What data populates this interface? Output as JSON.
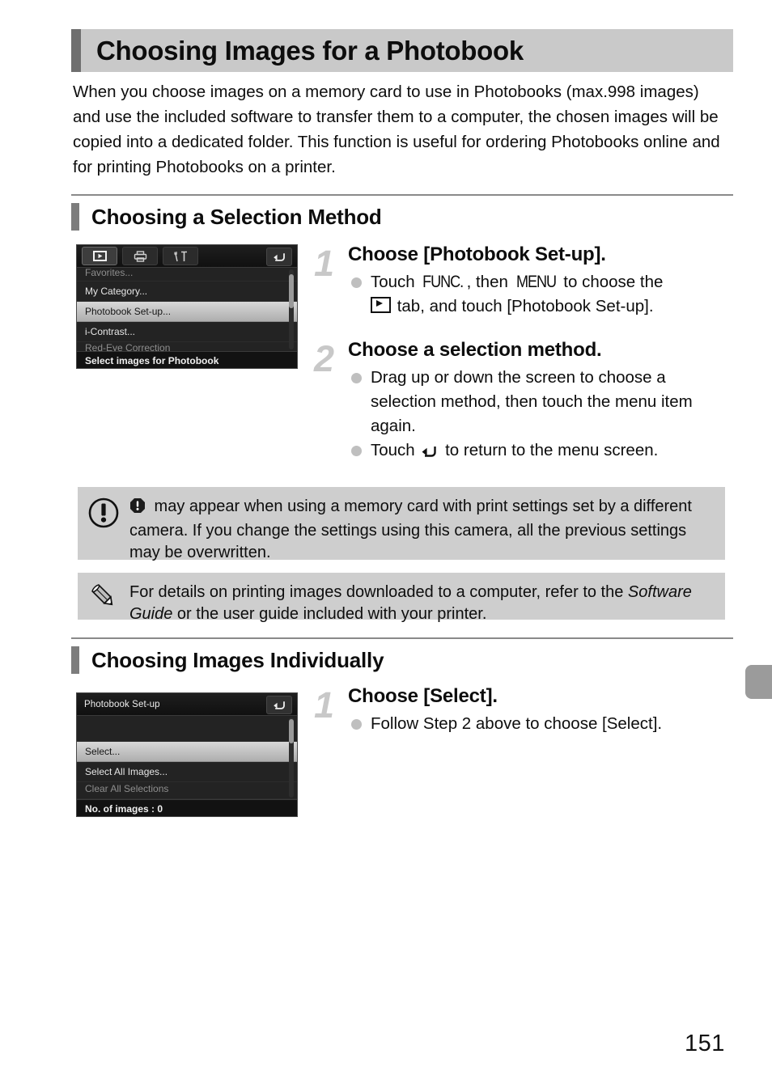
{
  "page": {
    "title": "Choosing Images for a Photobook",
    "number": "151",
    "intro": "When you choose images on a memory card to use in Photobooks (max.998 images) and use the included software to transfer them to a computer, the chosen images will be copied into a dedicated folder. This function is useful for ordering Photobooks online and for printing Photobooks on a printer."
  },
  "sections": [
    {
      "heading": "Choosing a Selection Method"
    },
    {
      "heading": "Choosing Images Individually"
    }
  ],
  "camera_screen_1": {
    "tabs": [
      {
        "icon": "playback-tab-icon",
        "active": true
      },
      {
        "icon": "print-tab-icon",
        "active": false
      },
      {
        "icon": "settings-tab-icon",
        "active": false
      }
    ],
    "back_icon": "back-arrow-icon",
    "items": [
      {
        "label": "Favorites...",
        "state": "dim-top"
      },
      {
        "label": "My Category...",
        "state": "normal"
      },
      {
        "label": "Photobook Set-up...",
        "state": "highlight"
      },
      {
        "label": "i-Contrast...",
        "state": "normal"
      },
      {
        "label": "Red-Eye Correction",
        "state": "dim-bottom"
      }
    ],
    "status": "Select images for Photobook"
  },
  "camera_screen_2": {
    "title": "Photobook Set-up",
    "back_icon": "back-arrow-icon",
    "items": [
      {
        "label": "",
        "state": "blank"
      },
      {
        "label": "Select...",
        "state": "highlight"
      },
      {
        "label": "Select All Images...",
        "state": "normal"
      },
      {
        "label": "Clear All Selections",
        "state": "dim-bottom"
      }
    ],
    "status": "No. of images : 0"
  },
  "steps": [
    {
      "number": "1",
      "title": "Choose [Photobook Set-up].",
      "bullet_line_1_a": "Touch ",
      "bullet_func": "FUNC.",
      "bullet_line_1_b": ", then ",
      "bullet_menu": "MENU",
      "bullet_line_1_c": " to choose the",
      "bullet_line_2": " tab, and touch [Photobook Set-up]."
    },
    {
      "number": "2",
      "title": "Choose a selection method.",
      "bullets": [
        "Drag up or down the screen to choose a selection method, then touch the menu item again."
      ],
      "bullet_touch_a": "Touch ",
      "bullet_touch_b": " to return to the menu screen."
    },
    {
      "number": "1",
      "title": "Choose [Select].",
      "bullets": [
        "Follow Step 2 above to choose [Select]."
      ]
    }
  ],
  "callouts": {
    "warning": {
      "icon": "exclamation-circle-icon",
      "inline_icon": "exclamation-octagon-icon",
      "text": " may appear when using a memory card with print settings set by a different camera. If you change the settings using this camera, all the previous settings may be overwritten."
    },
    "note": {
      "icon": "pencil-icon",
      "text_before": "For details on printing images downloaded to a computer, refer to the ",
      "text_italic": "Software Guide",
      "text_after": " or the user guide included with your printer."
    }
  },
  "colors": {
    "banner_bg": "#c9c9c9",
    "accent_bar": "#6f6f6f",
    "callout_bg": "#cecece",
    "step_number": "#c8c8c8",
    "bullet_dot": "#bfbfbf",
    "edge_tab": "#9b9b9b"
  }
}
